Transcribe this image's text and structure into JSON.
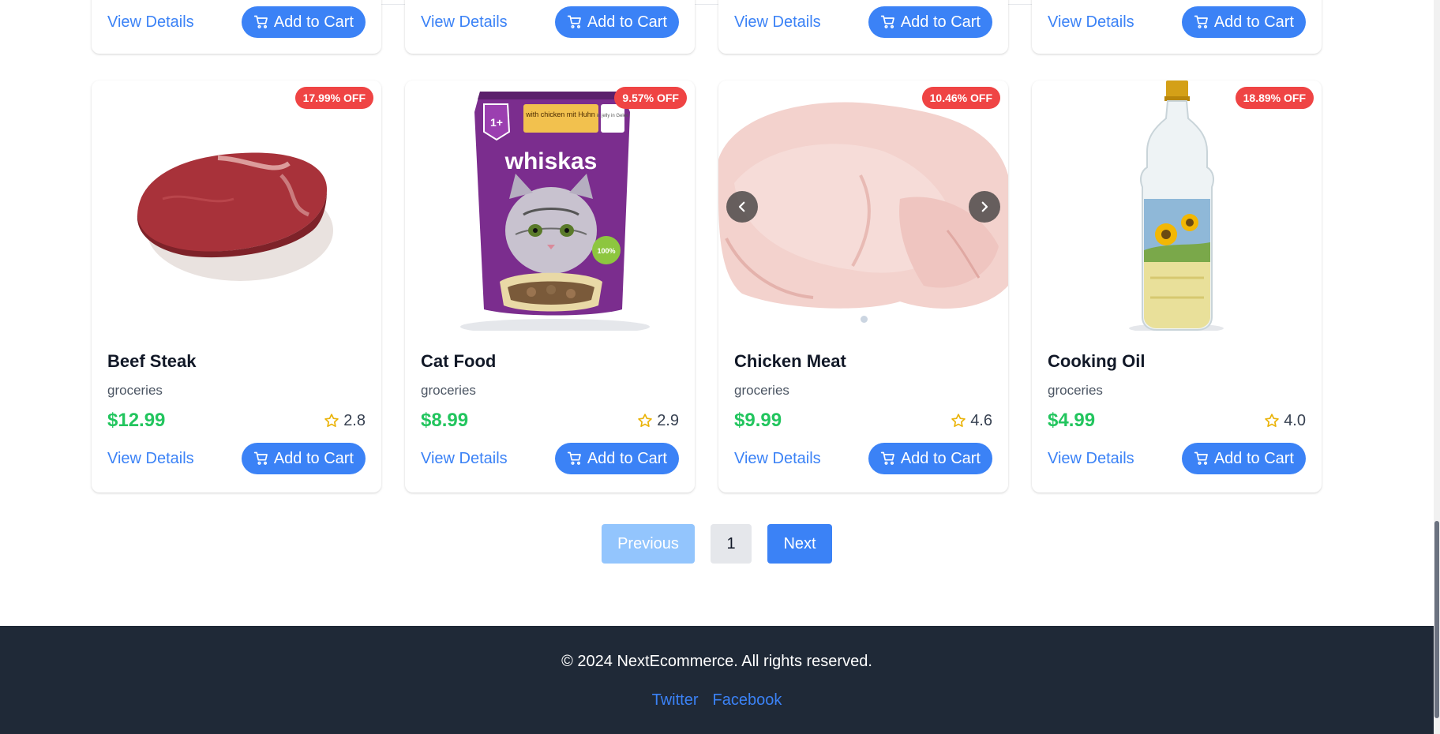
{
  "previous_row": [
    {
      "view_label": "View Details",
      "cart_label": "Add to Cart"
    },
    {
      "view_label": "View Details",
      "cart_label": "Add to Cart"
    },
    {
      "view_label": "View Details",
      "cart_label": "Add to Cart"
    },
    {
      "view_label": "View Details",
      "cart_label": "Add to Cart"
    }
  ],
  "products": [
    {
      "badge": "17.99% OFF",
      "name": "Beef Steak",
      "category": "groceries",
      "price": "$12.99",
      "rating": "2.8",
      "view_label": "View Details",
      "cart_label": "Add to Cart",
      "image": "steak-image"
    },
    {
      "badge": "9.57% OFF",
      "name": "Cat Food",
      "category": "groceries",
      "price": "$8.99",
      "rating": "2.9",
      "view_label": "View Details",
      "cart_label": "Add to Cart",
      "image": "cat-food-pouch-image",
      "pouch_brand": "whiskas",
      "pouch_age": "1+",
      "pouch_flavor": "with chicken mit Huhn",
      "pouch_side": "in jelly in Gelee",
      "pouch_seal": "100%"
    },
    {
      "badge": "10.46% OFF",
      "name": "Chicken Meat",
      "category": "groceries",
      "price": "$9.99",
      "rating": "4.6",
      "view_label": "View Details",
      "cart_label": "Add to Cart",
      "image": "raw-chicken-image"
    },
    {
      "badge": "18.89% OFF",
      "name": "Cooking Oil",
      "category": "groceries",
      "price": "$4.99",
      "rating": "4.0",
      "view_label": "View Details",
      "cart_label": "Add to Cart",
      "image": "oil-bottle-image"
    }
  ],
  "pagination": {
    "previous_label": "Previous",
    "current_page": "1",
    "next_label": "Next"
  },
  "footer": {
    "copyright": "© 2024 NextEcommerce. All rights reserved.",
    "links": [
      "Twitter",
      "Facebook"
    ]
  },
  "colors": {
    "accent": "#3b82f6",
    "badge": "#ef4444",
    "price": "#22c55e",
    "footer_bg": "#1f2937",
    "star": "#eab308"
  },
  "icons": {
    "cart": "cart-icon",
    "star": "star-outline-icon",
    "prev_arrow": "chevron-left-icon",
    "next_arrow": "chevron-right-icon"
  }
}
